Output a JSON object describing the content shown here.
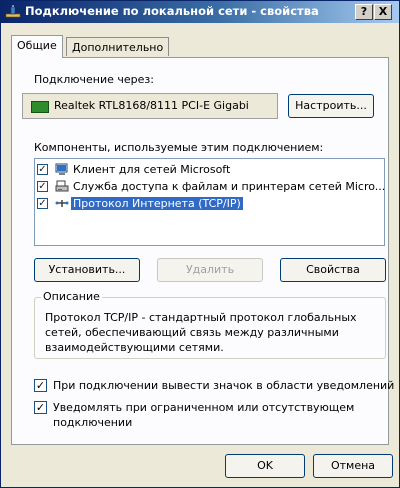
{
  "window": {
    "title": "Подключение по локальной сети - свойства",
    "help_button": "?",
    "close_button": "X"
  },
  "tabs": [
    {
      "label": "Общие"
    },
    {
      "label": "Дополнительно"
    }
  ],
  "connect_via": {
    "label": "Подключение через:",
    "adapter": "Realtek RTL8168/8111 PCI-E Gigabi",
    "configure_button": "Настроить..."
  },
  "components": {
    "label": "Компоненты, используемые этим подключением:",
    "items": [
      {
        "label": "Клиент для сетей Microsoft",
        "icon": "network-client-icon",
        "checked": true,
        "selected": false
      },
      {
        "label": "Служба доступа к файлам и принтерам сетей Micro...",
        "icon": "file-printer-sharing-icon",
        "checked": true,
        "selected": false
      },
      {
        "label": "Протокол Интернета (TCP/IP)",
        "icon": "tcpip-protocol-icon",
        "checked": true,
        "selected": true
      }
    ]
  },
  "buttons": {
    "install": "Установить...",
    "remove": "Удалить",
    "properties": "Свойства",
    "ok": "OK",
    "cancel": "Отмена"
  },
  "description": {
    "legend": "Описание",
    "text": "Протокол TCP/IP - стандартный протокол глобальных сетей, обеспечивающий связь между различными взаимодействующими сетями."
  },
  "options": {
    "show_icon": {
      "label": "При подключении вывести значок в области уведомлений",
      "checked": true
    },
    "notify": {
      "label": "Уведомлять при ограниченном или отсутствующем подключении",
      "checked": true
    }
  },
  "colors": {
    "titlebar": "#0a246a",
    "selection": "#316ac5",
    "dialog_bg": "#ece9d8",
    "panel_bg": "#fcfcfe"
  }
}
